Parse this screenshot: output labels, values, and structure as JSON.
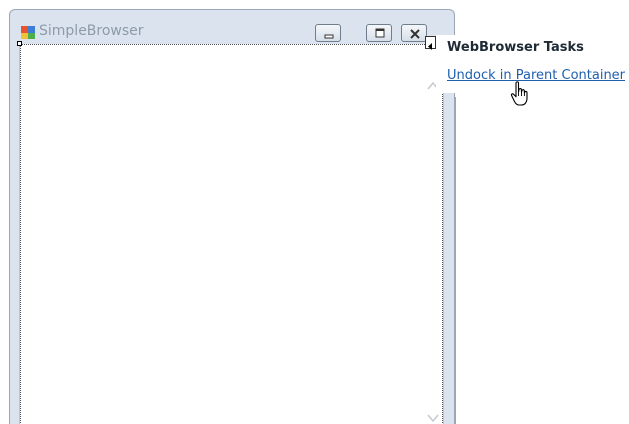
{
  "window": {
    "title": "SimpleBrowser",
    "icon": "form-app-icon",
    "caption_buttons": [
      "minimize-icon",
      "maximize-icon",
      "close-icon"
    ]
  },
  "smart_tag": {
    "icon": "smart-tag-arrow-icon"
  },
  "task_panel": {
    "header": "WebBrowser Tasks",
    "link_label": "Undock in Parent Container"
  },
  "cursor": {
    "icon": "hand-pointer-icon"
  },
  "colors": {
    "link": "#1f5fad",
    "frame": "#dbe4ee",
    "title_text": "#8d9aa8"
  }
}
